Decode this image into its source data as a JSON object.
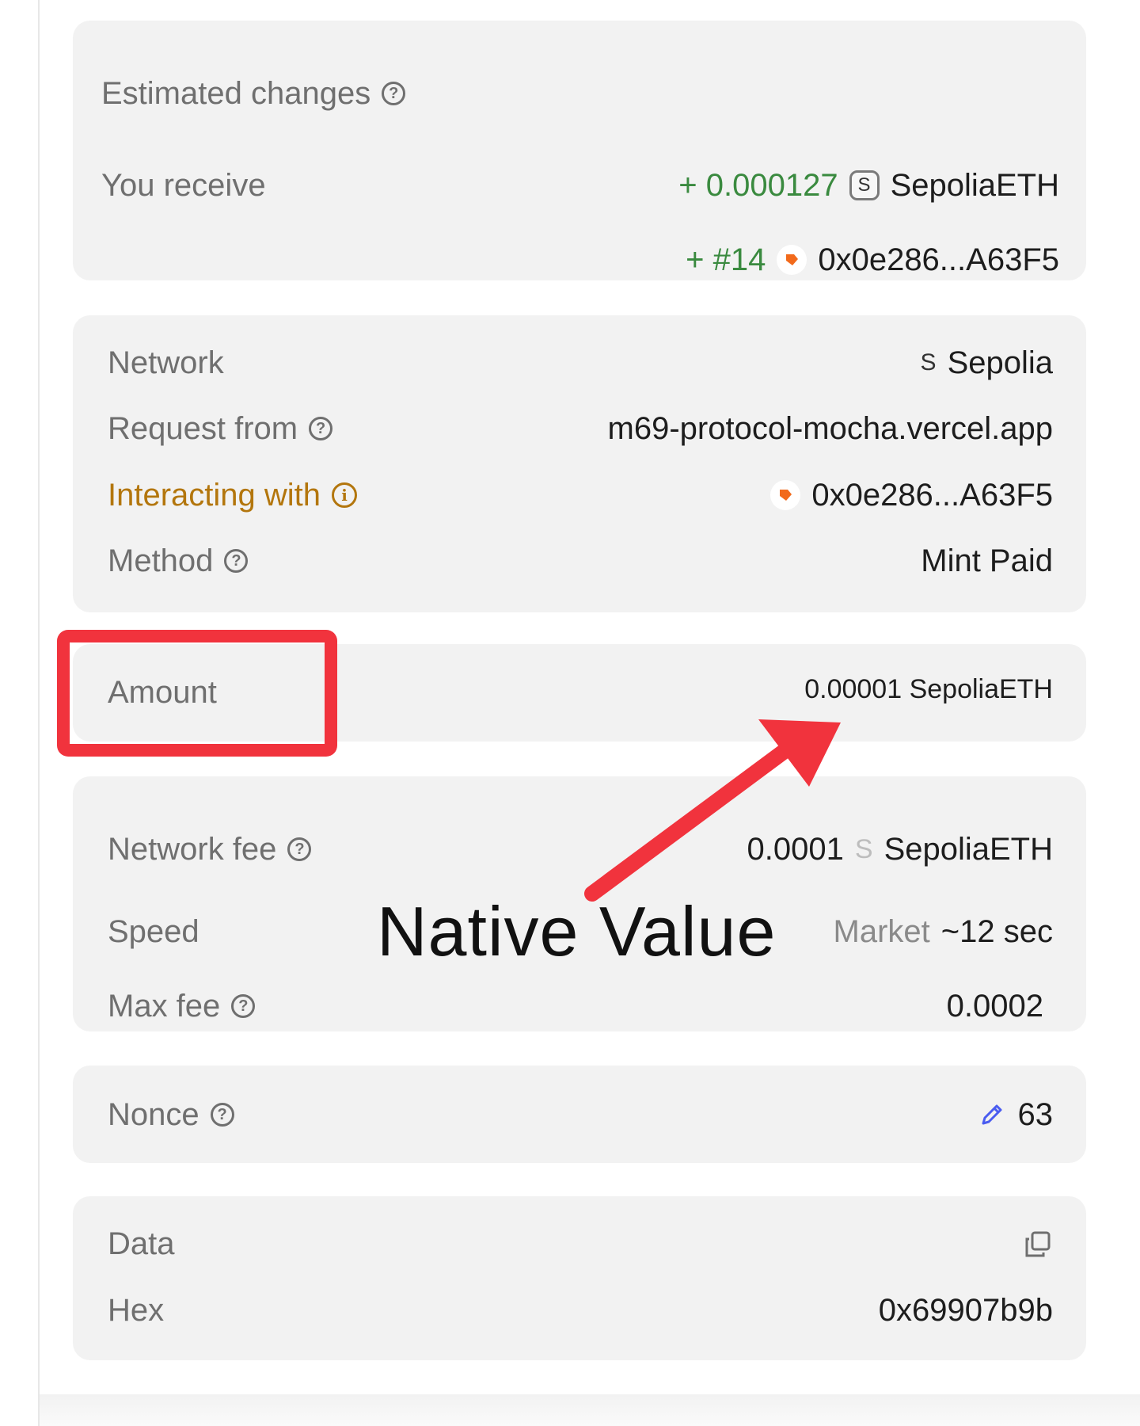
{
  "estimated_changes": {
    "title": "Estimated changes",
    "receive_label": "You receive",
    "receive_amount": "+ 0.000127",
    "receive_token_badge": "S",
    "receive_token": "SepoliaETH",
    "nft_change": "+ #14",
    "nft_address": "0x0e286...A63F5"
  },
  "details": {
    "network_label": "Network",
    "network_badge": "S",
    "network_value": "Sepolia",
    "request_label": "Request from",
    "request_value": "m69-protocol-mocha.vercel.app",
    "interacting_label": "Interacting with",
    "interacting_value": "0x0e286...A63F5",
    "method_label": "Method",
    "method_value": "Mint Paid"
  },
  "amount": {
    "label": "Amount",
    "value": "0.00001 SepoliaETH"
  },
  "fees": {
    "network_fee_label": "Network fee",
    "network_fee_value": "0.0001",
    "network_fee_badge": "S",
    "network_fee_token": "SepoliaETH",
    "speed_label": "Speed",
    "speed_mode": "Market",
    "speed_time": "~12 sec",
    "max_fee_label": "Max fee",
    "max_fee_value": "0.0002"
  },
  "nonce": {
    "label": "Nonce",
    "value": "63"
  },
  "data_section": {
    "label": "Data",
    "hex_label": "Hex",
    "hex_value": "0x69907b9b"
  },
  "annotation": {
    "text": "Native Value"
  },
  "icons": {
    "help": "help-circle-icon",
    "info": "info-circle-icon",
    "contract": "contract-avatar-icon",
    "edit": "pencil-icon",
    "copy": "copy-icon"
  },
  "colors": {
    "card_bg": "#f2f2f2",
    "positive": "#3a8a3f",
    "warning": "#b3760d",
    "annotation_red": "#f1333d",
    "edit_blue": "#4a5cf0",
    "contract_orange": "#f26a1b"
  }
}
